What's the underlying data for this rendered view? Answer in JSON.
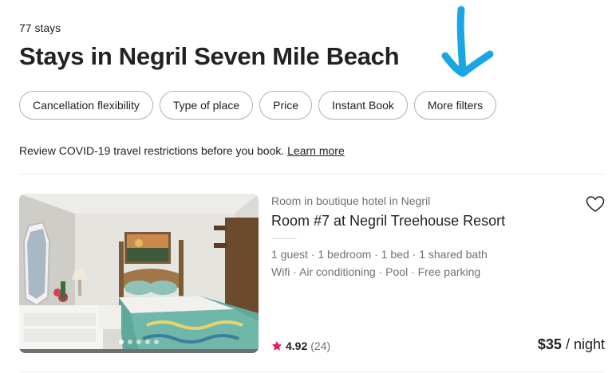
{
  "header": {
    "stays_count": "77 stays",
    "title": "Stays in Negril Seven Mile Beach"
  },
  "filters": [
    {
      "label": "Cancellation flexibility"
    },
    {
      "label": "Type of place"
    },
    {
      "label": "Price"
    },
    {
      "label": "Instant Book"
    },
    {
      "label": "More filters"
    }
  ],
  "covid_notice": {
    "text": "Review COVID-19 travel restrictions before you book.",
    "link": "Learn more"
  },
  "listing": {
    "type": "Room in boutique hotel in Negril",
    "name": "Room #7 at Negril Treehouse Resort",
    "details": "1 guest · 1 bedroom · 1 bed · 1 shared bath",
    "amenities": "Wifi · Air conditioning · Pool · Free parking",
    "rating": "4.92",
    "reviews": "(24)",
    "price": "$35",
    "price_unit": "/ night",
    "photo_count": 5,
    "active_photo": 1
  },
  "colors": {
    "arrow": "#1aa6e4",
    "star": "#e31c5f",
    "text": "#222222",
    "muted": "#717171"
  },
  "icons": [
    "down-arrow-annotation",
    "heart-icon",
    "star-icon"
  ]
}
